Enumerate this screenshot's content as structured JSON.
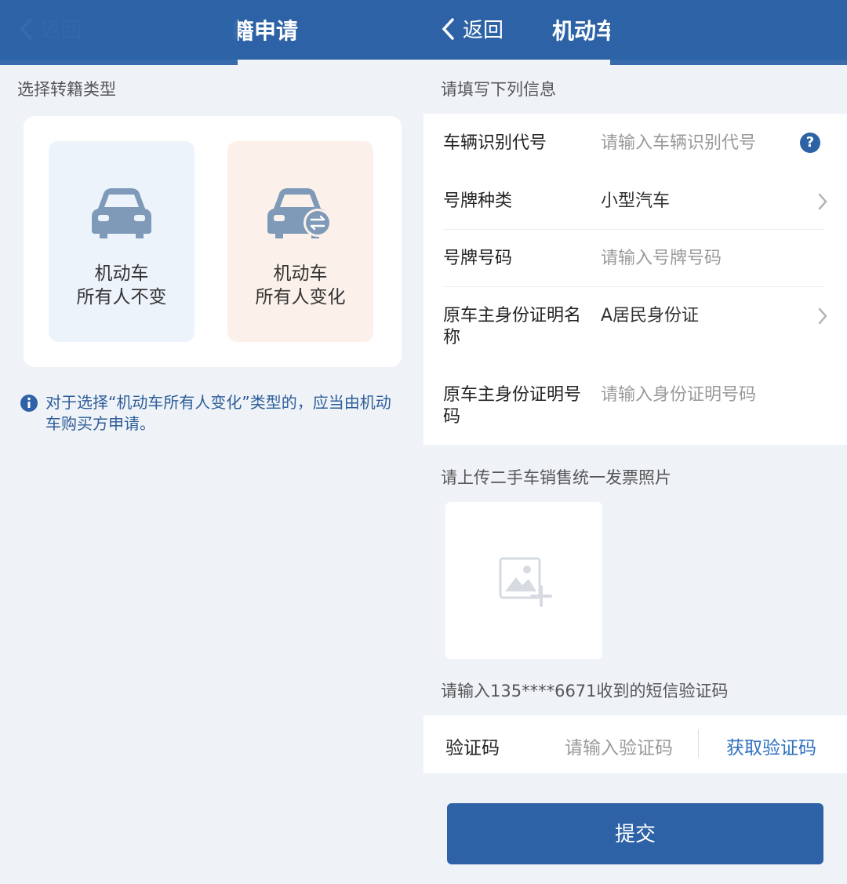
{
  "left": {
    "nav": {
      "back_label": "返回",
      "title": "籍申请"
    },
    "section_label": "选择转籍类型",
    "options": [
      {
        "line1": "机动车",
        "line2": "所有人不变"
      },
      {
        "line1": "机动车",
        "line2": "所有人变化"
      }
    ],
    "notice": "对于选择“机动车所有人变化”类型的，应当由机动车购买方申请。"
  },
  "right": {
    "nav": {
      "back_label": "返回",
      "title": "机动车"
    },
    "section_label": "请填写下列信息",
    "fields": [
      {
        "label": "车辆识别代号",
        "placeholder": "请输入车辆识别代号"
      },
      {
        "label": "号牌种类",
        "value": "小型汽车"
      },
      {
        "label": "号牌号码",
        "placeholder": "请输入号牌号码"
      },
      {
        "label": "原车主身份证明名称",
        "value": "A居民身份证"
      },
      {
        "label": "原车主身份证明号码",
        "placeholder": "请输入身份证明号码"
      }
    ],
    "help_glyph": "?",
    "upload_label": "请上传二手车销售统一发票照片",
    "sms_label": "请输入135****6671收到的短信验证码",
    "code": {
      "label": "验证码",
      "placeholder": "请输入验证码",
      "get_label": "获取验证码"
    },
    "submit_label": "提交"
  },
  "colors": {
    "primary": "#2d63a6",
    "background": "#eff3f8",
    "notice_text": "#2d5d98",
    "link": "#2d70c0"
  }
}
